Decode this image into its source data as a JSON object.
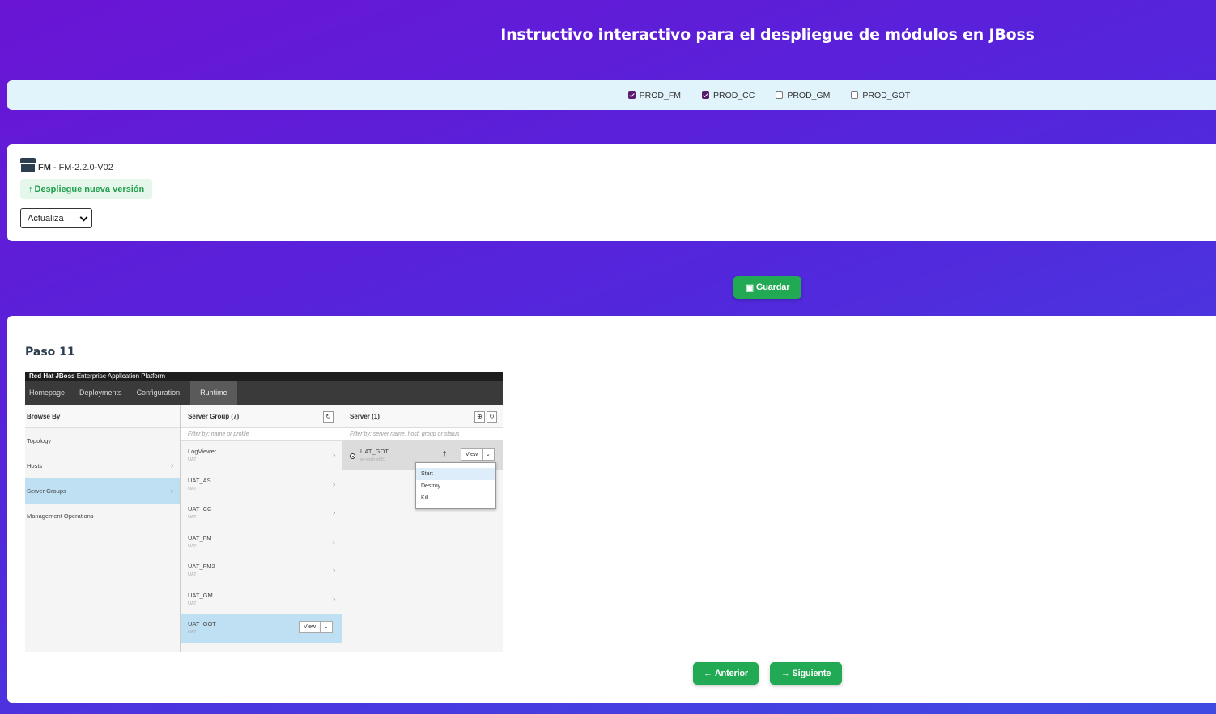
{
  "page": {
    "title": "Instructivo interactivo para el despliegue de módulos en JBoss"
  },
  "environments": [
    {
      "label": "PROD_FM",
      "checked": true
    },
    {
      "label": "PROD_CC",
      "checked": true
    },
    {
      "label": "PROD_GM",
      "checked": false
    },
    {
      "label": "PROD_GOT",
      "checked": false
    }
  ],
  "module": {
    "name": "FM",
    "separator": "-",
    "version": "FM-2.2.0-V02",
    "deploy_label": "Despliegue nueva versión",
    "action_selected": "Actualiza"
  },
  "buttons": {
    "save": "Guardar",
    "prev": "Anterior",
    "next": "Siguiente"
  },
  "step": {
    "title": "Paso 11"
  },
  "screenshot": {
    "brand_bold": "Red Hat JBoss",
    "brand_rest": " Enterprise Application Platform",
    "nav": [
      "Homepage",
      "Deployments",
      "Configuration",
      "Runtime"
    ],
    "browse_header": "Browse By",
    "browse_items": [
      "Topology",
      "Hosts",
      "Server Groups",
      "Management Operations"
    ],
    "group_header": "Server Group (7)",
    "group_filter": "Filter by: name or profile",
    "groups": [
      {
        "name": "LogViewer",
        "sub": "UAT"
      },
      {
        "name": "UAT_AS",
        "sub": "UAT"
      },
      {
        "name": "UAT_CC",
        "sub": "UAT"
      },
      {
        "name": "UAT_FM",
        "sub": "UAT"
      },
      {
        "name": "UAT_FM2",
        "sub": "UAT"
      },
      {
        "name": "UAT_GM",
        "sub": "UAT"
      },
      {
        "name": "UAT_GOT",
        "sub": "UAT"
      }
    ],
    "server_header": "Server (1)",
    "server_filter": "Filter by: server name, host, group or status",
    "server": {
      "name": "UAT_GOT",
      "sub": "sv-pcrh-sh01"
    },
    "view_label": "View",
    "menu": [
      "Start",
      "Destroy",
      "Kill"
    ]
  }
}
